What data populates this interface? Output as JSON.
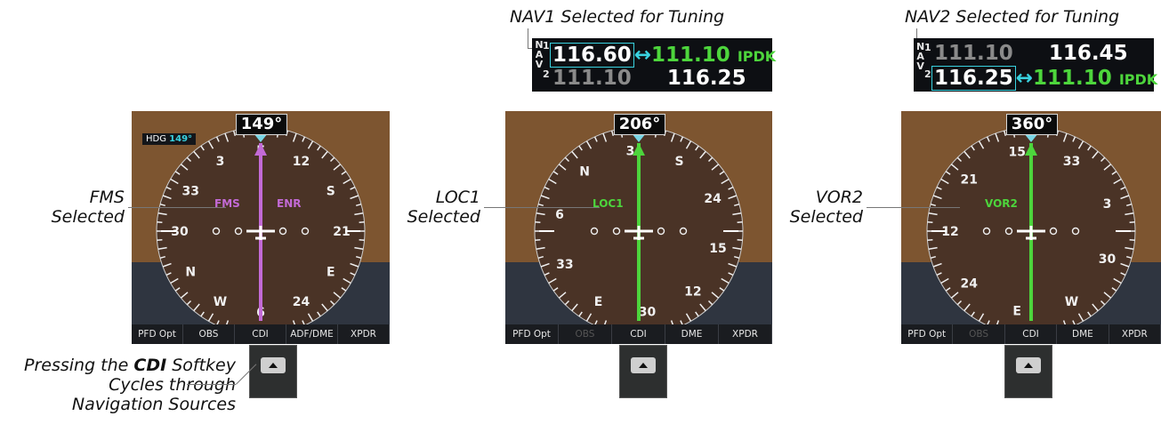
{
  "panels": [
    {
      "heading": "149°",
      "hdg_label": "HDG",
      "hdg_value": "149°",
      "source": "FMS",
      "source_color": "#c36ad6",
      "extra_label": "ENR",
      "rose_labels": [
        "12",
        "S",
        "21",
        "E",
        "24",
        "6",
        "W",
        "N",
        "30",
        "33",
        "3",
        "E"
      ],
      "softkeys": [
        "PFD Opt",
        "OBS",
        "CDI",
        "ADF/DME",
        "XPDR"
      ],
      "callout": [
        "FMS",
        "Selected"
      ],
      "rotation": 149
    },
    {
      "heading": "206°",
      "source": "LOC1",
      "source_color": "#4dd53c",
      "rose_labels": [
        "S",
        "24",
        "15",
        "12",
        "30",
        "E",
        "33",
        "6",
        "N",
        "3"
      ],
      "softkeys": [
        "PFD Opt",
        "OBS",
        "CDI",
        "DME",
        "XPDR"
      ],
      "callout": [
        "LOC1",
        "Selected"
      ],
      "rotation": 206
    },
    {
      "heading": "360°",
      "source": "VOR2",
      "source_color": "#4dd53c",
      "rose_labels": [
        "33",
        "3",
        "30",
        "W",
        "E",
        "24",
        "12",
        "21",
        "15"
      ],
      "softkeys": [
        "PFD Opt",
        "OBS",
        "CDI",
        "DME",
        "XPDR"
      ],
      "callout": [
        "VOR2",
        "Selected"
      ],
      "rotation": 0
    }
  ],
  "nav1_callout": "NAV1 Selected for Tuning",
  "nav2_callout": "NAV2 Selected for Tuning",
  "nav1_box": {
    "letters": [
      "N",
      "1",
      "A",
      "V",
      "2"
    ],
    "row1_active": "116.60",
    "row1_arrow": "↔",
    "row1_standby": "111.10",
    "row1_ident": "IPDK",
    "row2_active": "111.10",
    "row2_standby": "116.25"
  },
  "nav2_box": {
    "letters": [
      "N",
      "1",
      "A",
      "V",
      "2"
    ],
    "row1_active": "111.10",
    "row1_standby": "116.45",
    "row2_active": "116.25",
    "row2_arrow": "↔",
    "row2_standby": "111.10",
    "row2_ident": "IPDK"
  },
  "cdi_callout": {
    "line1_pre": "Pressing the ",
    "line1_key": "CDI",
    "line1_post": " Softkey",
    "line2": "Cycles through",
    "line3": "Navigation Sources"
  }
}
